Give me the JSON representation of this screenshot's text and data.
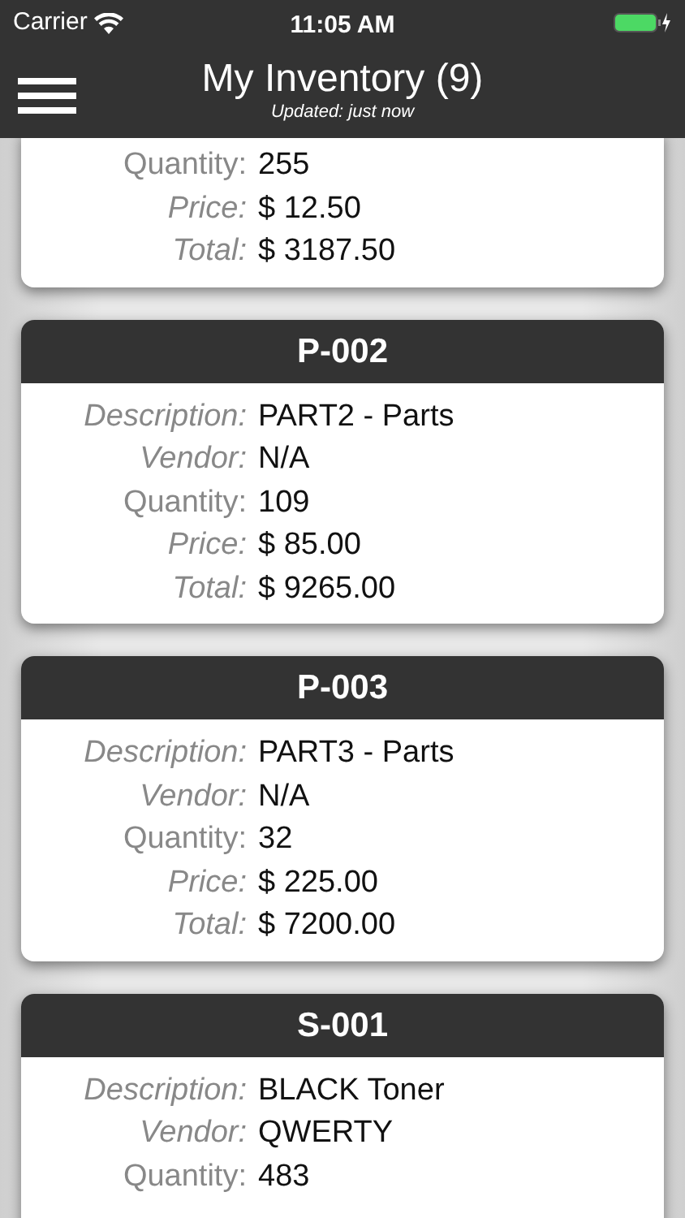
{
  "status_bar": {
    "carrier": "Carrier",
    "time": "11:05 AM"
  },
  "nav": {
    "title": "My Inventory (9)",
    "subtitle": "Updated: just now"
  },
  "items": [
    {
      "fields": [
        {
          "label": "Quantity:",
          "value": "255",
          "italic": false
        },
        {
          "label": "Price:",
          "value": "$ 12.50",
          "italic": true
        },
        {
          "label": "Total:",
          "value": "$ 3187.50",
          "italic": true
        }
      ]
    },
    {
      "code": "P-002",
      "fields": [
        {
          "label": "Description:",
          "value": "PART2 - Parts",
          "italic": true
        },
        {
          "label": "Vendor:",
          "value": "N/A",
          "italic": true
        },
        {
          "label": "Quantity:",
          "value": "109",
          "italic": false
        },
        {
          "label": "Price:",
          "value": "$ 85.00",
          "italic": true
        },
        {
          "label": "Total:",
          "value": "$ 9265.00",
          "italic": true
        }
      ]
    },
    {
      "code": "P-003",
      "fields": [
        {
          "label": "Description:",
          "value": "PART3 - Parts",
          "italic": true
        },
        {
          "label": "Vendor:",
          "value": "N/A",
          "italic": true
        },
        {
          "label": "Quantity:",
          "value": "32",
          "italic": false
        },
        {
          "label": "Price:",
          "value": "$ 225.00",
          "italic": true
        },
        {
          "label": "Total:",
          "value": "$ 7200.00",
          "italic": true
        }
      ]
    },
    {
      "code": "S-001",
      "fields": [
        {
          "label": "Description:",
          "value": "BLACK Toner",
          "italic": true
        },
        {
          "label": "Vendor:",
          "value": "QWERTY",
          "italic": true
        },
        {
          "label": "Quantity:",
          "value": "483",
          "italic": false
        }
      ]
    }
  ]
}
